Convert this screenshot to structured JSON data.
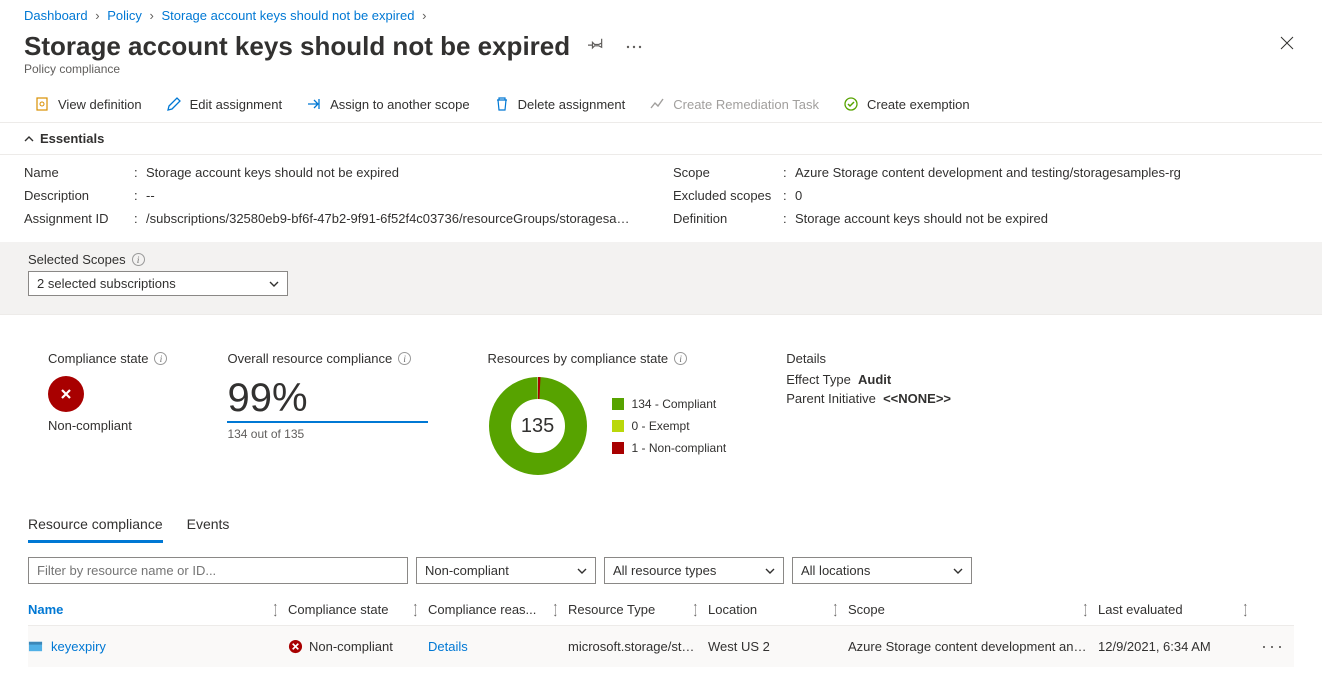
{
  "breadcrumb": {
    "items": [
      "Dashboard",
      "Policy",
      "Storage account keys should not be expired"
    ]
  },
  "header": {
    "title": "Storage account keys should not be expired",
    "subtitle": "Policy compliance"
  },
  "toolbar": {
    "view_def": "View definition",
    "edit_assign": "Edit assignment",
    "assign_scope": "Assign to another scope",
    "delete_assign": "Delete assignment",
    "create_remediation": "Create Remediation Task",
    "create_exemption": "Create exemption"
  },
  "essentials": {
    "heading": "Essentials",
    "left": {
      "name_label": "Name",
      "name_value": "Storage account keys should not be expired",
      "desc_label": "Description",
      "desc_value": "--",
      "assign_label": "Assignment ID",
      "assign_value": "/subscriptions/32580eb9-bf6f-47b2-9f91-6f52f4c03736/resourceGroups/storagesa…"
    },
    "right": {
      "scope_label": "Scope",
      "scope_value": "Azure Storage content development and testing/storagesamples-rg",
      "excl_label": "Excluded scopes",
      "excl_value": "0",
      "def_label": "Definition",
      "def_value": "Storage account keys should not be expired"
    }
  },
  "scopes": {
    "label": "Selected Scopes",
    "value": "2 selected subscriptions"
  },
  "dashboard": {
    "compliance_state": {
      "title": "Compliance state",
      "value": "Non-compliant"
    },
    "overall": {
      "title": "Overall resource compliance",
      "pct": "99%",
      "sub": "134 out of 135"
    },
    "bystate": {
      "title": "Resources by compliance state",
      "total": "135",
      "legend": [
        {
          "color": "#57a300",
          "label": "134 - Compliant"
        },
        {
          "color": "#bad80a",
          "label": "0 - Exempt"
        },
        {
          "color": "#a80000",
          "label": "1 - Non-compliant"
        }
      ]
    },
    "details": {
      "title": "Details",
      "effect_label": "Effect Type",
      "effect_value": "Audit",
      "parent_label": "Parent Initiative",
      "parent_value": "<<NONE>>"
    }
  },
  "chart_data": {
    "type": "pie",
    "title": "Resources by compliance state",
    "total": 135,
    "series": [
      {
        "name": "Compliant",
        "value": 134,
        "color": "#57a300"
      },
      {
        "name": "Exempt",
        "value": 0,
        "color": "#bad80a"
      },
      {
        "name": "Non-compliant",
        "value": 1,
        "color": "#a80000"
      }
    ]
  },
  "tabs": {
    "resource": "Resource compliance",
    "events": "Events"
  },
  "filters": {
    "text_placeholder": "Filter by resource name or ID...",
    "state": "Non-compliant",
    "type": "All resource types",
    "location": "All locations"
  },
  "grid": {
    "headers": {
      "name": "Name",
      "state": "Compliance state",
      "reason": "Compliance reas...",
      "rtype": "Resource Type",
      "location": "Location",
      "scope": "Scope",
      "last": "Last evaluated"
    },
    "row": {
      "name": "keyexpiry",
      "state": "Non-compliant",
      "reason": "Details",
      "rtype": "microsoft.storage/st…",
      "location": "West US 2",
      "scope": "Azure Storage content development an…",
      "last": "12/9/2021, 6:34 AM"
    }
  }
}
